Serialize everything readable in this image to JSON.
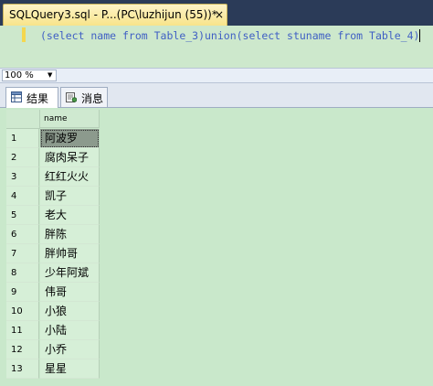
{
  "tab": {
    "title": "SQLQuery3.sql - P...(PC\\luzhijun (55))*",
    "close_glyph": "×"
  },
  "editor": {
    "sql": "(select name from Table_3)union(select stuname from Table_4)"
  },
  "zoom": {
    "value": "100 %",
    "arrow_icon": "chevron-down-icon"
  },
  "result_tabs": [
    {
      "label": "结果",
      "icon": "grid-icon",
      "active": true
    },
    {
      "label": "消息",
      "icon": "messages-icon",
      "active": false
    }
  ],
  "grid": {
    "columns": [
      "name"
    ],
    "rows": [
      {
        "num": "1",
        "name": "阿波罗"
      },
      {
        "num": "2",
        "name": "腐肉呆子"
      },
      {
        "num": "3",
        "name": "红红火火"
      },
      {
        "num": "4",
        "name": "凯子"
      },
      {
        "num": "5",
        "name": "老大"
      },
      {
        "num": "6",
        "name": "胖陈"
      },
      {
        "num": "7",
        "name": "胖帅哥"
      },
      {
        "num": "8",
        "name": "少年阿斌"
      },
      {
        "num": "9",
        "name": "伟哥"
      },
      {
        "num": "10",
        "name": "小狼"
      },
      {
        "num": "11",
        "name": "小陆"
      },
      {
        "num": "12",
        "name": "小乔"
      },
      {
        "num": "13",
        "name": "星星"
      }
    ]
  },
  "colors": {
    "tab_strip": "#2b3b58",
    "doc_tab": "#f8e48a",
    "editor_bg": "#cde8cc",
    "sql_text": "#3f5fc4",
    "selected_cell": "#8c9a8d"
  }
}
